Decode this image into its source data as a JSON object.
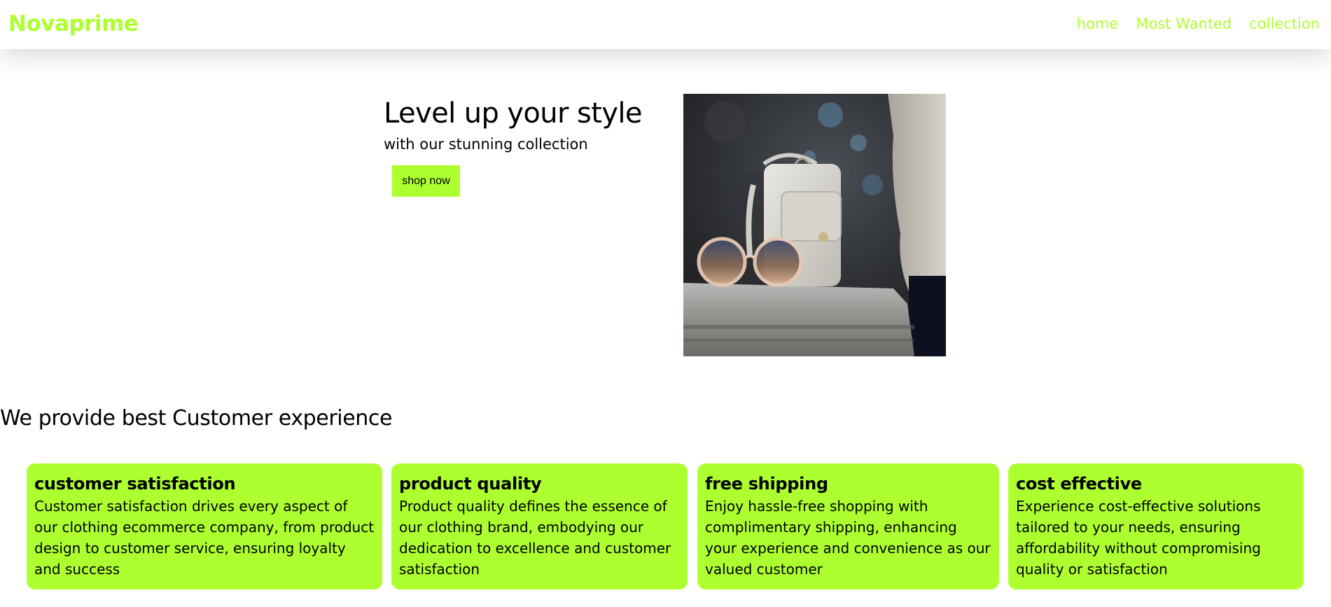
{
  "nav": {
    "brand": "Novaprime",
    "links": [
      "home",
      "Most Wanted",
      "collection"
    ]
  },
  "hero": {
    "title": "Level up your style",
    "subtitle": "with our stunning collection",
    "cta_label": "shop now"
  },
  "features": {
    "heading": "We provide best Customer experience",
    "cards": [
      {
        "title": "customer satisfaction",
        "text": "Customer satisfaction drives every aspect of our clothing ecommerce company, from product design to customer service, ensuring loyalty and success"
      },
      {
        "title": "product quality",
        "text": "Product quality defines the essence of our clothing brand, embodying our dedication to excellence and customer satisfaction"
      },
      {
        "title": "free shipping",
        "text": "Enjoy hassle-free shopping with complimentary shipping, enhancing your experience and convenience as our valued customer"
      },
      {
        "title": "cost effective",
        "text": "Experience cost-effective solutions tailored to your needs, ensuring affordability without compromising quality or satisfaction"
      }
    ]
  },
  "colors": {
    "accent": "#adff2f",
    "text": "#000000",
    "background": "#ffffff"
  }
}
